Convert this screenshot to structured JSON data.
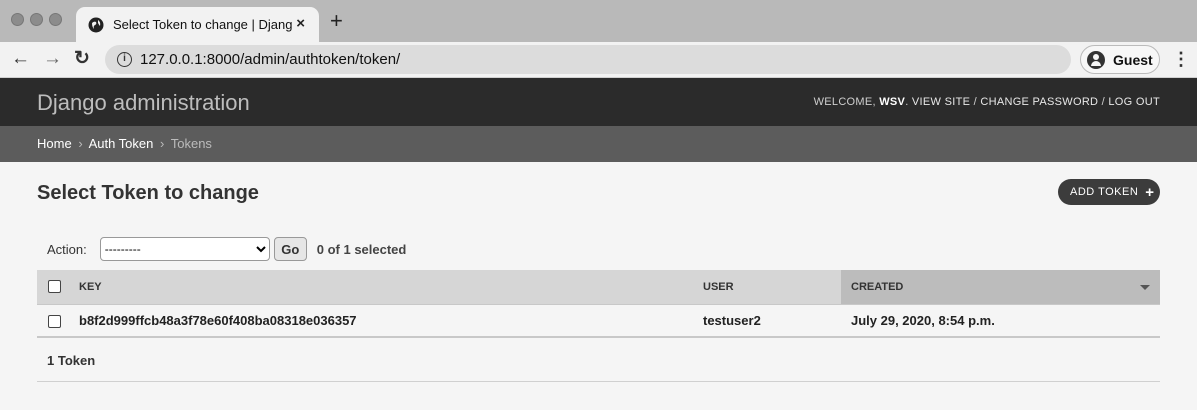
{
  "browser": {
    "tab_title": "Select Token to change | Djang",
    "tab_close": "×",
    "new_tab": "+",
    "url": "127.0.0.1:8000/admin/authtoken/token/",
    "profile_label": "Guest",
    "icons": [
      "globe-icon",
      "back-icon",
      "forward-icon",
      "reload-icon",
      "info-icon",
      "avatar-icon",
      "menu-icon"
    ]
  },
  "header": {
    "brand": "Django administration",
    "welcome": "WELCOME,",
    "username": "WSV",
    "view_site": "VIEW SITE",
    "change_password": "CHANGE PASSWORD",
    "log_out": "LOG OUT",
    "separator": " / "
  },
  "breadcrumbs": {
    "home": "Home",
    "app": "Auth Token",
    "current": "Tokens",
    "sep": "›"
  },
  "content": {
    "title": "Select Token to change",
    "add_button": "ADD TOKEN",
    "add_plus": "+",
    "action_label": "Action:",
    "action_selected": "---------",
    "go_button": "Go",
    "selection_counter": "0 of 1 selected"
  },
  "table": {
    "columns": [
      "KEY",
      "USER",
      "CREATED"
    ],
    "rows": [
      {
        "key": "b8f2d999ffcb48a3f78e60f408ba08318e036357",
        "user": "testuser2",
        "created": "July 29, 2020, 8:54 p.m."
      }
    ]
  },
  "paginator": "1 Token"
}
